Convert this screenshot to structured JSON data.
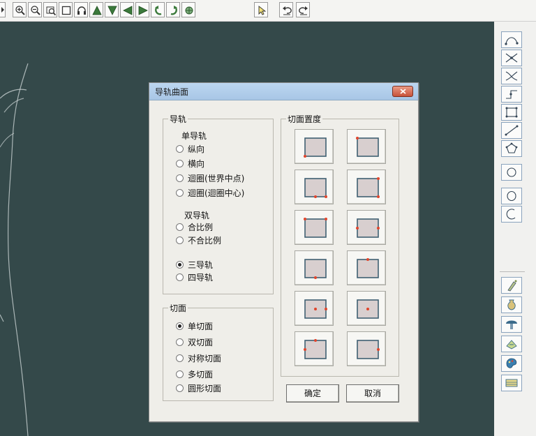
{
  "toolbar": {
    "icons": [
      "caret-right-icon",
      "zoom-in-icon",
      "zoom-out-icon",
      "zoom-window-icon",
      "rectangle-icon",
      "headphones-icon",
      "arrow-up-icon",
      "arrow-down-icon",
      "arrow-left-icon",
      "arrow-right-icon",
      "rotate-left-icon",
      "rotate-right-icon",
      "rotate-view-icon",
      "pointer-icon",
      "undo-icon",
      "redo-icon"
    ]
  },
  "right_toolbar": {
    "icons": [
      "curve-bezier-icon",
      "curve-cross-icon",
      "curve-merge-icon",
      "curve-step-icon",
      "box-grid-icon",
      "line-icon",
      "polygon-icon",
      "circle-icon",
      "ellipse-icon",
      "arc-icon",
      "spray-icon",
      "vase-icon",
      "mushroom-icon",
      "fill-icon",
      "palette-icon",
      "layers-icon"
    ]
  },
  "dialog": {
    "title": "导轨曲面",
    "rail_group": {
      "title": "导轨",
      "single_title": "单导轨",
      "single_options": [
        "纵向",
        "横向",
        "迴圈(世界中点)",
        "迴圈(迴圈中心)"
      ],
      "double_title": "双导轨",
      "double_options": [
        "合比例",
        "不合比例"
      ],
      "other_options": [
        "三导轨",
        "四导轨"
      ],
      "selected": "三导轨"
    },
    "section_group": {
      "title": "切面",
      "options": [
        "单切面",
        "双切面",
        "对称切面",
        "多切面",
        "圆形切面"
      ],
      "selected": "单切面"
    },
    "placement_group": {
      "title": "切面置度",
      "tile_count": 12
    },
    "ok_label": "确定",
    "cancel_label": "取消"
  },
  "colors": {
    "canvas": "#34494a",
    "title_bar": "#bcd6f0",
    "close_button": "#c7523a",
    "marker": "#e0452c",
    "tile_square": "#d8cfcf"
  }
}
